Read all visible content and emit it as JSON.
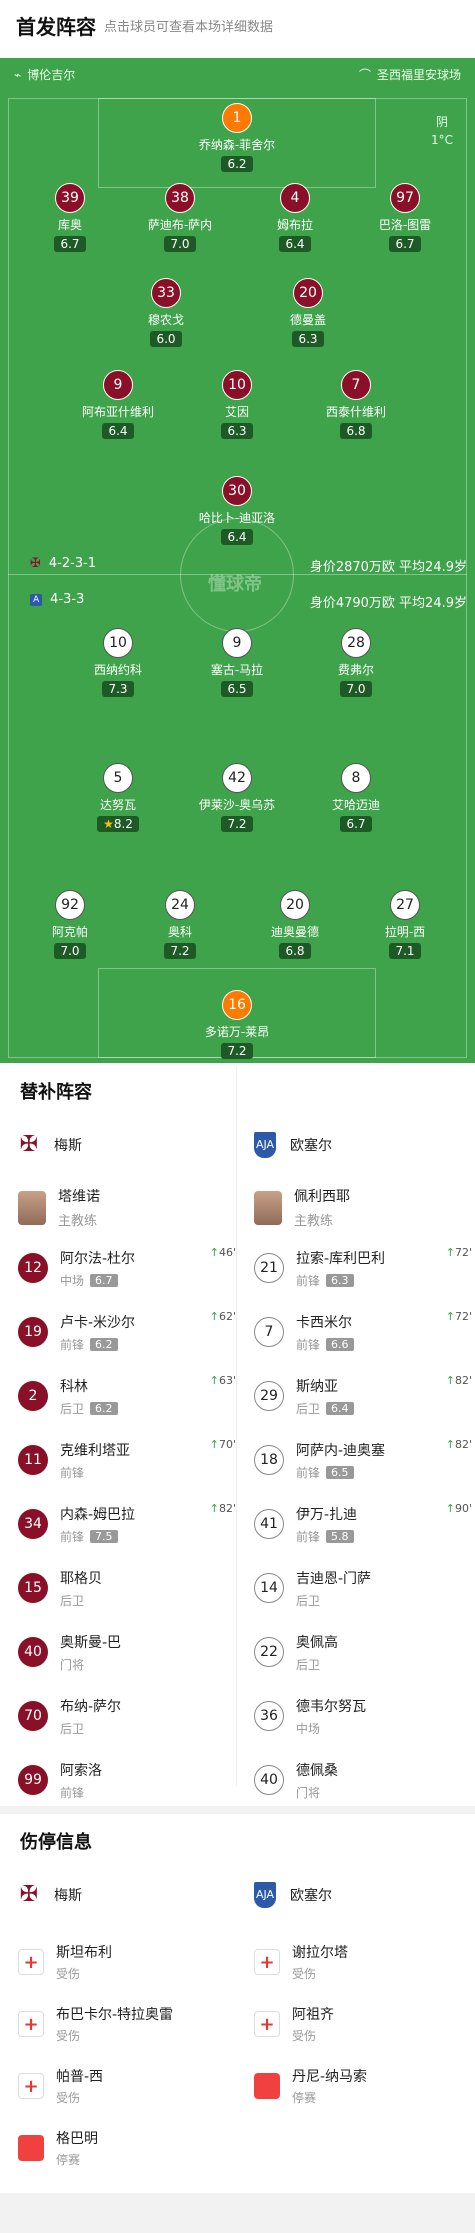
{
  "header": {
    "title": "首发阵容",
    "subtitle": "点击球员可查看本场详细数据"
  },
  "pitch": {
    "home_stadium": "博伦吉尔",
    "away_stadium": "圣西福里安球场",
    "weather": "阴",
    "temperature": "1°C",
    "watermark": "懂球帝",
    "home_formation": "4-2-3-1",
    "home_value": "身价2870万欧 平均24.9岁",
    "away_formation": "4-3-3",
    "away_value": "身价4790万欧 平均24.9岁",
    "home_players": [
      {
        "num": "1",
        "name": "乔纳森-菲舍尔",
        "rating": "6.2",
        "gk": true
      },
      {
        "num": "39",
        "name": "库奥",
        "rating": "6.7",
        "sub": "63'",
        "yellow": true
      },
      {
        "num": "38",
        "name": "萨迪布-萨内",
        "rating": "7.0"
      },
      {
        "num": "4",
        "name": "姆布拉",
        "rating": "6.4"
      },
      {
        "num": "97",
        "name": "巴洛-图雷",
        "rating": "6.7",
        "sub": "62'"
      },
      {
        "num": "33",
        "name": "穆农戈",
        "rating": "6.0"
      },
      {
        "num": "20",
        "name": "德曼盖",
        "rating": "6.3",
        "sub": "46'"
      },
      {
        "num": "9",
        "name": "阿布亚什维利",
        "rating": "6.4",
        "sub": "82'"
      },
      {
        "num": "10",
        "name": "艾因",
        "rating": "6.3",
        "sub": "70'"
      },
      {
        "num": "7",
        "name": "西泰什维利",
        "rating": "6.8"
      },
      {
        "num": "30",
        "name": "哈比卜-迪亚洛",
        "rating": "6.4",
        "cap": true
      }
    ],
    "away_players": [
      {
        "num": "10",
        "name": "西纳约科",
        "rating": "7.3",
        "yellow": true
      },
      {
        "num": "9",
        "name": "塞古-马拉",
        "rating": "6.5",
        "sub": "72'"
      },
      {
        "num": "28",
        "name": "费弗尔",
        "rating": "7.0",
        "sub": "72'"
      },
      {
        "num": "5",
        "name": "达努瓦",
        "rating": "8.2",
        "sub": "90'",
        "best": true
      },
      {
        "num": "42",
        "name": "伊莱沙-奥乌苏",
        "rating": "7.2",
        "cap": true
      },
      {
        "num": "8",
        "name": "艾哈迈迪",
        "rating": "6.7",
        "sub": "82'"
      },
      {
        "num": "92",
        "name": "阿克帕",
        "rating": "7.0"
      },
      {
        "num": "24",
        "name": "奥科",
        "rating": "7.2"
      },
      {
        "num": "20",
        "name": "迪奥曼德",
        "rating": "6.8"
      },
      {
        "num": "27",
        "name": "拉明-西",
        "rating": "7.1",
        "sub": "82'"
      },
      {
        "num": "16",
        "name": "多诺万-莱昂",
        "rating": "7.2",
        "gk": true
      }
    ]
  },
  "subs": {
    "title": "替补阵容",
    "home_team": "梅斯",
    "away_team": "欧塞尔",
    "home_coach": {
      "name": "塔维诺",
      "role": "主教练"
    },
    "away_coach": {
      "name": "佩利西耶",
      "role": "主教练"
    },
    "home": [
      {
        "num": "12",
        "name": "阿尔法-杜尔",
        "pos": "中场",
        "rating": "6.7",
        "evt": "46'"
      },
      {
        "num": "19",
        "name": "卢卡-米沙尔",
        "pos": "前锋",
        "rating": "6.2",
        "evt": "62'"
      },
      {
        "num": "2",
        "name": "科林",
        "pos": "后卫",
        "rating": "6.2",
        "evt": "63'"
      },
      {
        "num": "11",
        "name": "克维利塔亚",
        "pos": "前锋",
        "rating": "",
        "evt": "70'"
      },
      {
        "num": "34",
        "name": "内森-姆巴拉",
        "pos": "前锋",
        "rating": "7.5",
        "evt": "82'"
      },
      {
        "num": "15",
        "name": "耶格贝",
        "pos": "后卫",
        "rating": "",
        "evt": ""
      },
      {
        "num": "40",
        "name": "奥斯曼-巴",
        "pos": "门将",
        "rating": "",
        "evt": ""
      },
      {
        "num": "70",
        "name": "布纳-萨尔",
        "pos": "后卫",
        "rating": "",
        "evt": ""
      },
      {
        "num": "99",
        "name": "阿索洛",
        "pos": "前锋",
        "rating": "",
        "evt": ""
      }
    ],
    "away": [
      {
        "num": "21",
        "name": "拉索-库利巴利",
        "pos": "前锋",
        "rating": "6.3",
        "evt": "72'"
      },
      {
        "num": "7",
        "name": "卡西米尔",
        "pos": "前锋",
        "rating": "6.6",
        "evt": "72'"
      },
      {
        "num": "29",
        "name": "斯纳亚",
        "pos": "后卫",
        "rating": "6.4",
        "evt": "82'"
      },
      {
        "num": "18",
        "name": "阿萨内-迪奥塞",
        "pos": "前锋",
        "rating": "6.5",
        "evt": "82'"
      },
      {
        "num": "41",
        "name": "伊万-扎迪",
        "pos": "前锋",
        "rating": "5.8",
        "evt": "90'"
      },
      {
        "num": "14",
        "name": "吉迪恩-门萨",
        "pos": "后卫",
        "rating": "",
        "evt": ""
      },
      {
        "num": "22",
        "name": "奥佩高",
        "pos": "后卫",
        "rating": "",
        "evt": ""
      },
      {
        "num": "36",
        "name": "德韦尔努瓦",
        "pos": "中场",
        "rating": "",
        "evt": ""
      },
      {
        "num": "40",
        "name": "德佩桑",
        "pos": "门将",
        "rating": "",
        "evt": ""
      }
    ]
  },
  "injuries": {
    "title": "伤停信息",
    "home_team": "梅斯",
    "away_team": "欧塞尔",
    "home": [
      {
        "name": "斯坦布利",
        "status": "受伤",
        "type": "injury"
      },
      {
        "name": "布巴卡尔-特拉奥雷",
        "status": "受伤",
        "type": "injury"
      },
      {
        "name": "帕普-西",
        "status": "受伤",
        "type": "injury"
      },
      {
        "name": "格巴明",
        "status": "停赛",
        "type": "red"
      }
    ],
    "away": [
      {
        "name": "谢拉尔塔",
        "status": "受伤",
        "type": "injury"
      },
      {
        "name": "阿祖齐",
        "status": "受伤",
        "type": "injury"
      },
      {
        "name": "丹尼-纳马索",
        "status": "停赛",
        "type": "red"
      }
    ]
  },
  "colors": {
    "pitch": "#3ea34a",
    "home": "#8a0f28",
    "away": "#ffffff",
    "rating_bg": "#1d5a26"
  }
}
